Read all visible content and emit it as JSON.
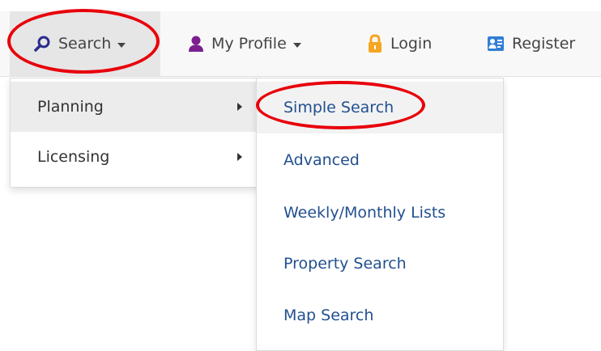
{
  "navbar": {
    "items": [
      {
        "label": "Search",
        "icon": "search-icon"
      },
      {
        "label": "My Profile",
        "icon": "user-icon"
      },
      {
        "label": "Login",
        "icon": "lock-icon"
      },
      {
        "label": "Register",
        "icon": "register-icon"
      }
    ]
  },
  "search_menu": {
    "items": [
      {
        "label": "Planning"
      },
      {
        "label": "Licensing"
      }
    ]
  },
  "planning_submenu": {
    "items": [
      {
        "label": "Simple Search"
      },
      {
        "label": "Advanced"
      },
      {
        "label": "Weekly/Monthly Lists"
      },
      {
        "label": "Property Search"
      },
      {
        "label": "Map Search"
      }
    ]
  },
  "colors": {
    "highlight_ring": "#e8000b",
    "search_icon": "#2b2a8c",
    "user_icon": "#7b1f8f",
    "lock_icon": "#f5a623",
    "register_icon": "#2f7fd6",
    "submenu_link": "#22508f"
  }
}
